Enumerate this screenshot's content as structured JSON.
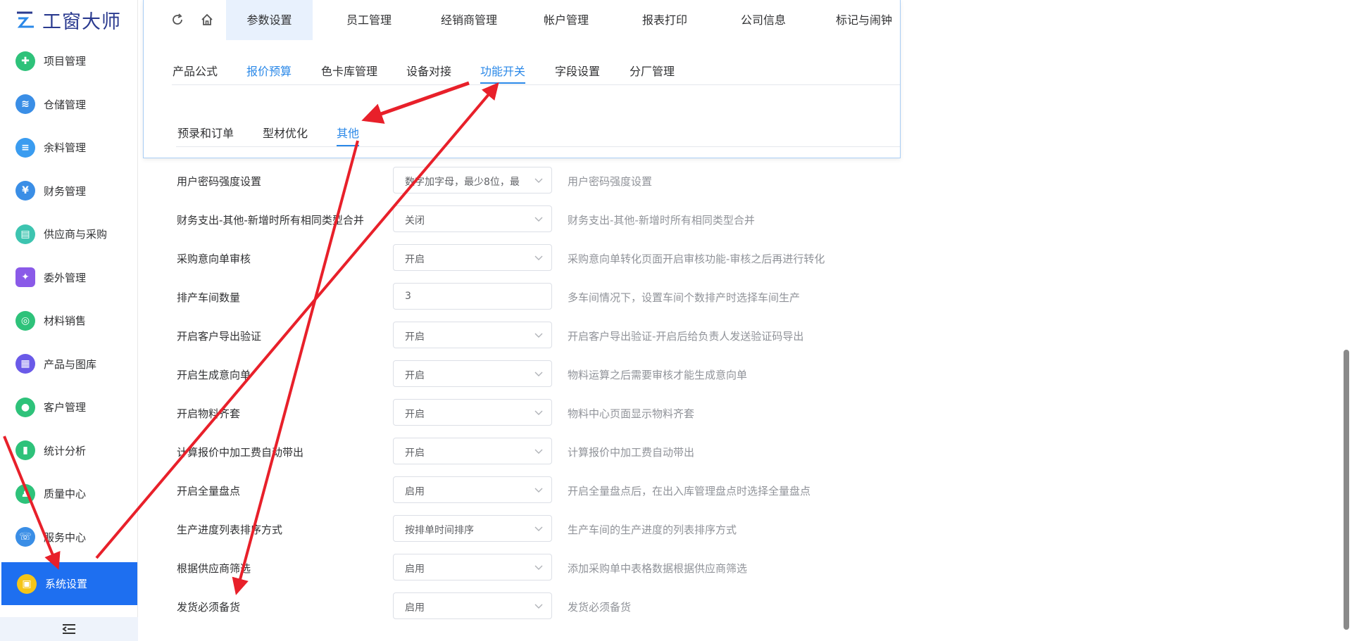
{
  "app": {
    "logo_text": "工窗大师"
  },
  "sidebar": {
    "items": [
      {
        "label": "项目管理",
        "icon": "project-icon",
        "color": "#2ec27a"
      },
      {
        "label": "仓储管理",
        "icon": "layers-icon",
        "color": "#3a8ee6"
      },
      {
        "label": "余料管理",
        "icon": "document-icon",
        "color": "#3a9cf0"
      },
      {
        "label": "财务管理",
        "icon": "finance-icon",
        "color": "#3a8ee6"
      },
      {
        "label": "供应商与采购",
        "icon": "supplier-icon",
        "color": "#3dc4b0"
      },
      {
        "label": "委外管理",
        "icon": "outsource-icon",
        "color": "#8a5ae8"
      },
      {
        "label": "材料销售",
        "icon": "sales-icon",
        "color": "#2ec27a"
      },
      {
        "label": "产品与图库",
        "icon": "product-icon",
        "color": "#6a5ae8"
      },
      {
        "label": "客户管理",
        "icon": "customer-icon",
        "color": "#2ec27a"
      },
      {
        "label": "统计分析",
        "icon": "chart-icon",
        "color": "#2ec27a"
      },
      {
        "label": "质量中心",
        "icon": "quality-icon",
        "color": "#2ec27a"
      },
      {
        "label": "服务中心",
        "icon": "phone-icon",
        "color": "#3a8ee6"
      }
    ],
    "active_item": {
      "label": "系统设置",
      "icon": "settings-icon",
      "color": "#f5c518"
    },
    "collapse_icon": "collapse-menu-icon"
  },
  "top_tabs": [
    "参数设置",
    "员工管理",
    "经销商管理",
    "帐户管理",
    "报表打印",
    "公司信息",
    "标记与闹钟"
  ],
  "active_top_tab": "参数设置",
  "sub_tabs": [
    "产品公式",
    "报价预算",
    "色卡库管理",
    "设备对接",
    "功能开关",
    "字段设置",
    "分厂管理"
  ],
  "active_sub_tab": "功能开关",
  "tertiary_tabs": [
    "预录和订单",
    "型材优化",
    "其他"
  ],
  "active_tertiary_tab": "其他",
  "settings": [
    {
      "label": "用户密码强度设置",
      "value": "数字加字母，最少8位，最",
      "type": "select",
      "desc": "用户密码强度设置"
    },
    {
      "label": "财务支出-其他-新增时所有相同类型合并",
      "value": "关闭",
      "type": "select",
      "desc": "财务支出-其他-新增时所有相同类型合并"
    },
    {
      "label": "采购意向单审核",
      "value": "开启",
      "type": "select",
      "desc": "采购意向单转化页面开启审核功能-审核之后再进行转化"
    },
    {
      "label": "排产车间数量",
      "value": "3",
      "type": "input",
      "desc": "多车间情况下，设置车间个数排产时选择车间生产"
    },
    {
      "label": "开启客户导出验证",
      "value": "开启",
      "type": "select",
      "desc": "开启客户导出验证-开启后给负责人发送验证码导出"
    },
    {
      "label": "开启生成意向单",
      "value": "开启",
      "type": "select",
      "desc": "物料运算之后需要审核才能生成意向单"
    },
    {
      "label": "开启物料齐套",
      "value": "开启",
      "type": "select",
      "desc": "物料中心页面显示物料齐套"
    },
    {
      "label": "计算报价中加工费自动带出",
      "value": "开启",
      "type": "select",
      "desc": "计算报价中加工费自动带出"
    },
    {
      "label": "开启全量盘点",
      "value": "启用",
      "type": "select",
      "desc": "开启全量盘点后，在出入库管理盘点时选择全量盘点"
    },
    {
      "label": "生产进度列表排序方式",
      "value": "按排单时间排序",
      "type": "select",
      "desc": "生产车间的生产进度的列表排序方式"
    },
    {
      "label": "根据供应商筛选",
      "value": "启用",
      "type": "select",
      "desc": "添加采购单中表格数据根据供应商筛选"
    },
    {
      "label": "发货必须备货",
      "value": "启用",
      "type": "select",
      "desc": "发货必须备货"
    }
  ],
  "colors": {
    "accent": "#2a88e8",
    "active_menu": "#1e6ff0",
    "annotation": "#e8202a"
  }
}
